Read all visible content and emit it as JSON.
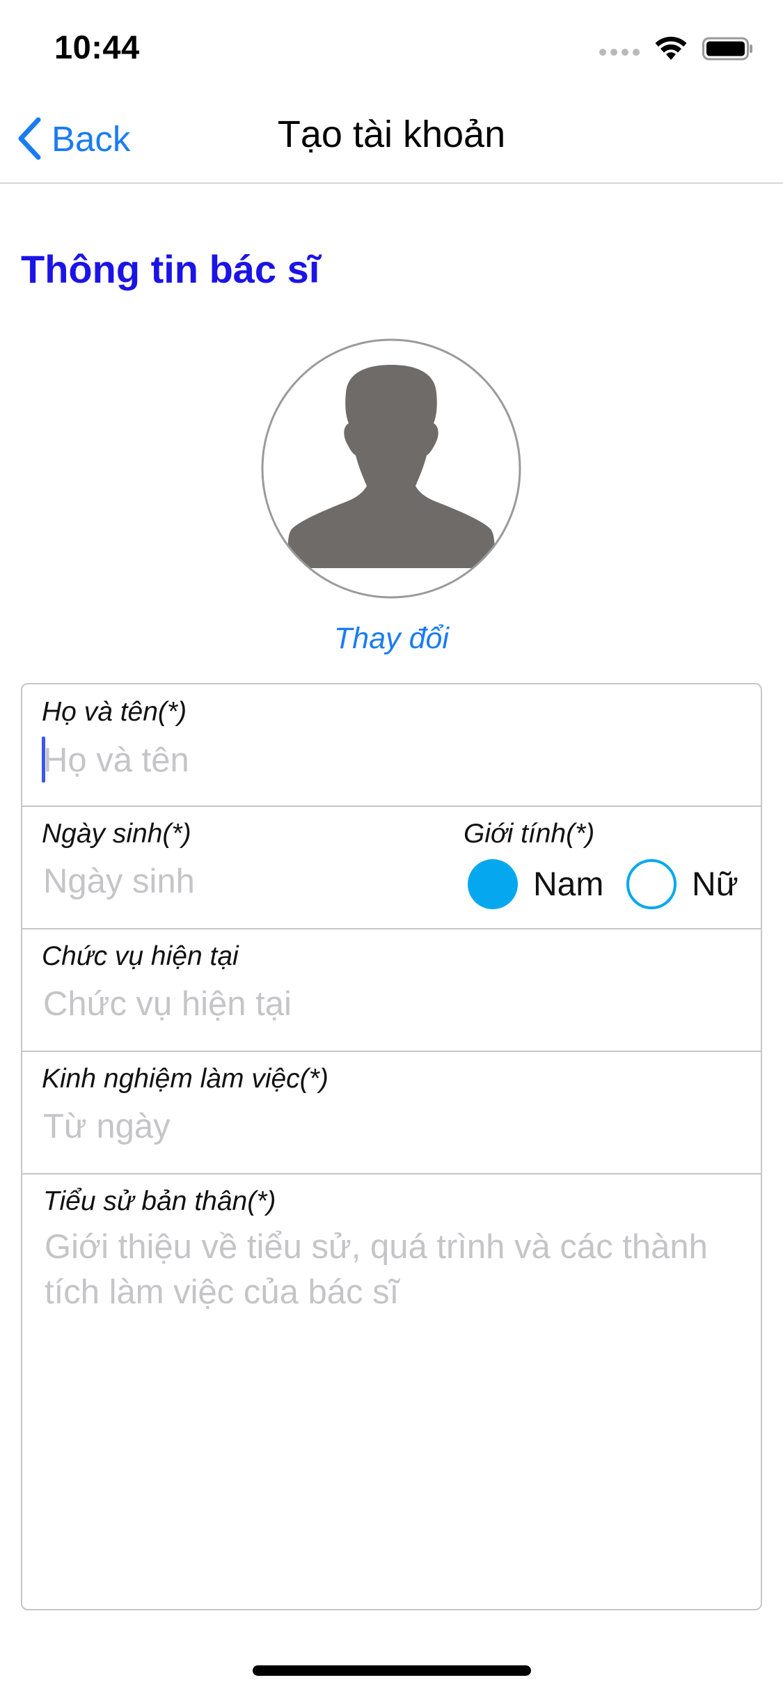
{
  "status_bar": {
    "time": "10:44",
    "icons": [
      "cellular-signal-icon",
      "wifi-icon",
      "battery-icon"
    ]
  },
  "nav": {
    "back_label": "Back",
    "title": "Tạo tài khoản"
  },
  "section": {
    "title": "Thông tin bác sĩ"
  },
  "avatar": {
    "icon": "person-silhouette-icon",
    "change_label": "Thay đổi"
  },
  "form": {
    "full_name": {
      "label": "Họ và tên(*)",
      "placeholder": "Họ và tên",
      "value": ""
    },
    "birth_date": {
      "label": "Ngày sinh(*)",
      "placeholder": "Ngày sinh",
      "value": ""
    },
    "gender": {
      "label": "Giới tính(*)",
      "options": [
        "Nam",
        "Nữ"
      ],
      "selected": "Nam"
    },
    "position": {
      "label": "Chức vụ hiện tại",
      "placeholder": "Chức vụ hiện tại",
      "value": ""
    },
    "experience": {
      "label": "Kinh nghiệm làm việc(*)",
      "placeholder": "Từ ngày",
      "value": ""
    },
    "biography": {
      "label": "Tiểu sử bản thân(*)",
      "placeholder": "Giới thiệu về tiểu sử, quá trình và các thành tích làm việc của bác sĩ",
      "value": ""
    }
  },
  "colors": {
    "accent_blue": "#1a7cf2",
    "heading_blue": "#1b14e6",
    "radio_blue": "#05a8ee",
    "placeholder_gray": "#c5c5c9",
    "border_gray": "#c6c6c8"
  }
}
